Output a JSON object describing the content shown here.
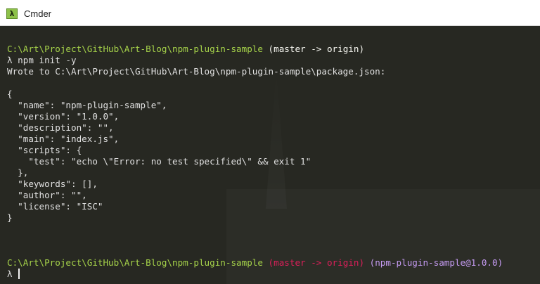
{
  "window": {
    "title": "Cmder",
    "icon_glyph": "λ",
    "icon_color": "#8dc149"
  },
  "terminal": {
    "prompt1": {
      "path": "C:\\Art\\Project\\GitHub\\Art-Blog\\npm-plugin-sample",
      "branch": "(master -> origin)"
    },
    "command": "λ npm init -y",
    "output": [
      "Wrote to C:\\Art\\Project\\GitHub\\Art-Blog\\npm-plugin-sample\\package.json:",
      "",
      "{",
      "  \"name\": \"npm-plugin-sample\",",
      "  \"version\": \"1.0.0\",",
      "  \"description\": \"\",",
      "  \"main\": \"index.js\",",
      "  \"scripts\": {",
      "    \"test\": \"echo \\\"Error: no test specified\\\" && exit 1\"",
      "  },",
      "  \"keywords\": [],",
      "  \"author\": \"\",",
      "  \"license\": \"ISC\"",
      "}"
    ],
    "prompt2": {
      "path": "C:\\Art\\Project\\GitHub\\Art-Blog\\npm-plugin-sample",
      "branch": "(master -> origin)",
      "package": "(npm-plugin-sample@1.0.0)"
    },
    "input_prompt": "λ",
    "colors": {
      "path": "#a6d34a",
      "branch_clean": "#f8f8f2",
      "branch_dirty": "#dd1f5a",
      "package": "#c59bf2"
    }
  }
}
